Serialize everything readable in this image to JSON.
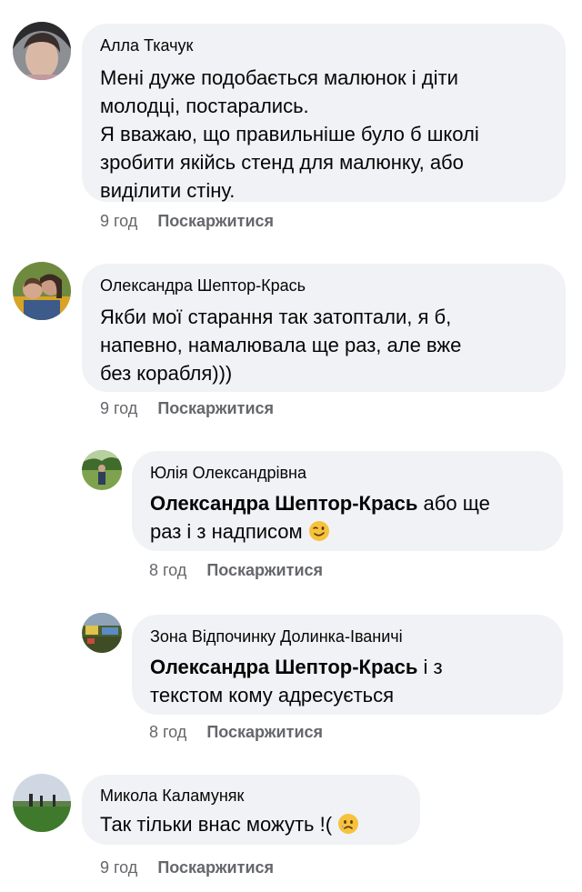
{
  "comments": [
    {
      "author": "Алла Ткачук",
      "lines": [
        "Мені дуже подобається малюнок і діти",
        "молодці, постарались.",
        "Я вважаю, що правильніше було б школі",
        "зробити якійсь стенд для малюнку, або",
        "виділити стіну."
      ],
      "time": "9 год",
      "report": "Поскаржитися"
    },
    {
      "author": "Олександра Шептор-Крась",
      "lines": [
        "Якби мої старання так затоптали, я б,",
        "напевно, намалювала ще раз, але вже",
        "без корабля)))"
      ],
      "time": "9 год",
      "report": "Поскаржитися"
    },
    {
      "author": "Юлія Олександрівна",
      "mention": "Олександра Шептор-Крась",
      "line1_rest": " або ще",
      "line2": "раз і з надписом",
      "emoji": "winking-face",
      "time": "8 год",
      "report": "Поскаржитися"
    },
    {
      "author": "Зона Відпочинку Долинка-Іваничі",
      "mention": "Олександра Шептор-Крась",
      "line1_rest": " і з",
      "line2": "текстом кому адресується",
      "time": "8 год",
      "report": "Поскаржитися"
    },
    {
      "author": "Микола Каламуняк",
      "text": "Так тільки внас можуть !(",
      "emoji": "sad-but-relieved-face",
      "time": "9 год",
      "report": "Поскаржитися"
    }
  ],
  "colors": {
    "bubble": "#f0f2f5",
    "meta": "#65676b",
    "text": "#050505"
  }
}
